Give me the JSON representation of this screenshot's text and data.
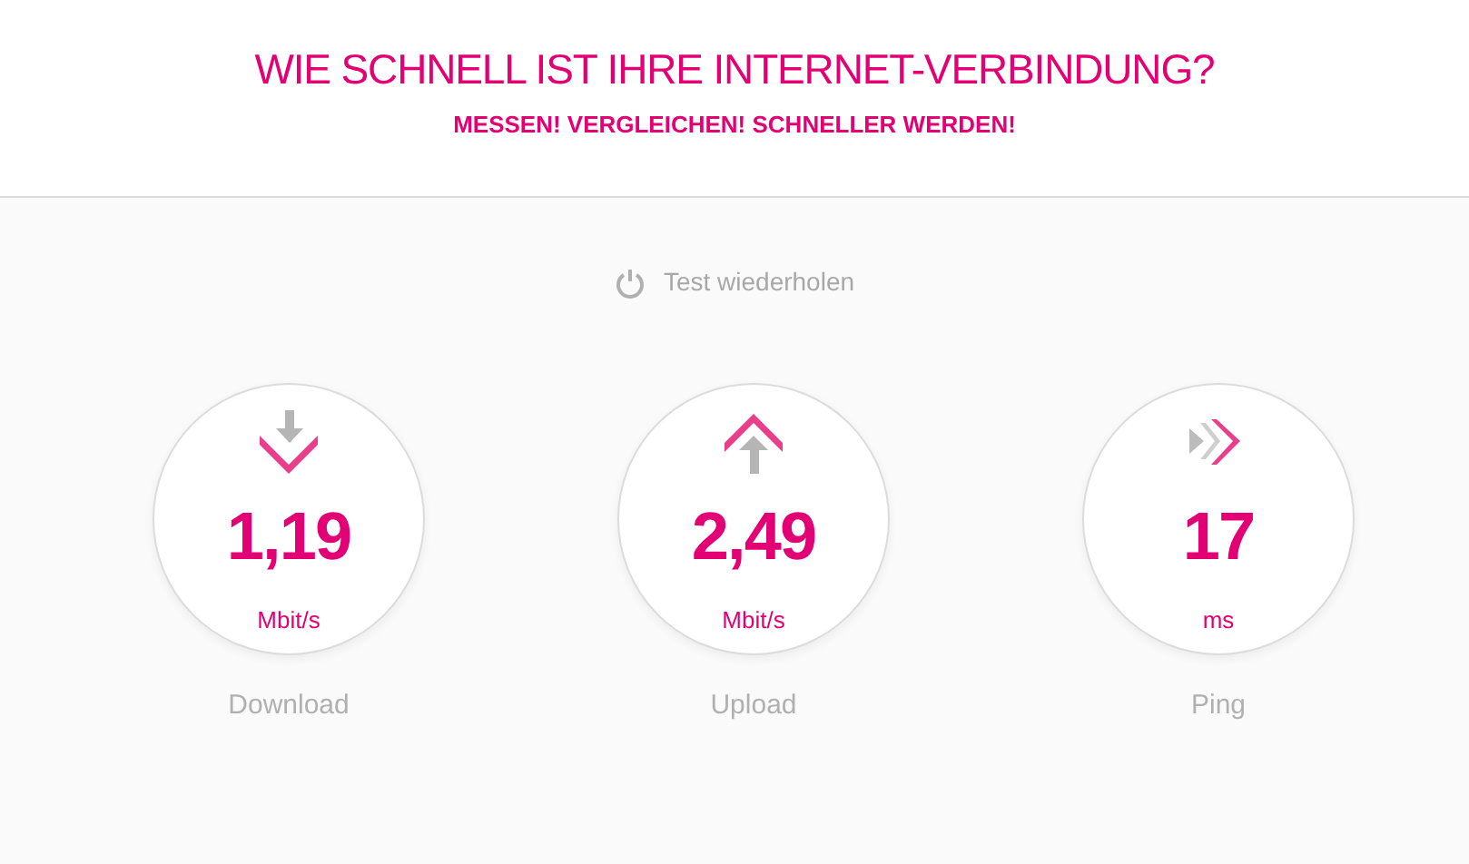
{
  "header": {
    "title": "WIE SCHNELL IST IHRE INTERNET-VERBINDUNG?",
    "subtitle": "MESSEN! VERGLEICHEN! SCHNELLER WERDEN!"
  },
  "repeat_button": {
    "label": "Test wiederholen"
  },
  "results": [
    {
      "kind": "download",
      "value": "1,19",
      "unit": "Mbit/s",
      "label": "Download"
    },
    {
      "kind": "upload",
      "value": "2,49",
      "unit": "Mbit/s",
      "label": "Upload"
    },
    {
      "kind": "ping",
      "value": "17",
      "unit": "ms",
      "label": "Ping"
    }
  ]
}
